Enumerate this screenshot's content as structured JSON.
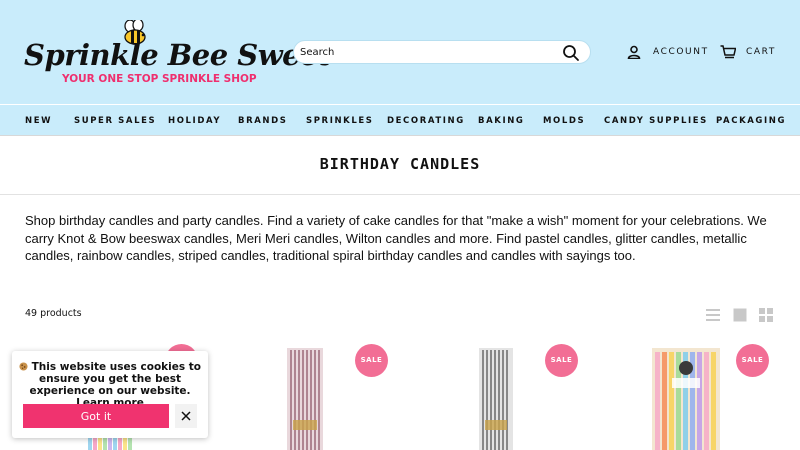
{
  "header": {
    "logo_title": "Sprinkle Bee Sweet",
    "logo_tm": "™",
    "logo_tagline": "YOUR ONE STOP SPRINKLE SHOP",
    "search_placeholder": "Search",
    "account_label": "ACCOUNT",
    "cart_label": "CART"
  },
  "nav": {
    "items": [
      "NEW",
      "SUPER SALES",
      "HOLIDAY",
      "BRANDS",
      "SPRINKLES",
      "DECORATING",
      "BAKING",
      "MOLDS",
      "CANDY SUPPLIES",
      "PACKAGING"
    ]
  },
  "collection": {
    "title": "BIRTHDAY CANDLES",
    "description": "Shop birthday candles and party candles. Find a variety of cake candles for that \"make a wish\" moment for your celebrations. We carry Knot & Bow beeswax candles, Meri Meri candles, Wilton candles and more. Find pastel candles, glitter candles, metallic candles, rainbow candles, striped candles, traditional spiral birthday candles and candles with sayings too.",
    "product_count": "49 products"
  },
  "products": [
    {
      "badge": "SALE"
    },
    {
      "badge": "SALE"
    },
    {
      "badge": "SALE"
    },
    {
      "badge": "SALE"
    }
  ],
  "cookie_banner": {
    "message_prefix": "This website uses cookies to ensure you get the best experience on our website.",
    "learn_more": "Learn more",
    "accept_label": "Got it"
  },
  "colors": {
    "header_bg": "#c9ecfb",
    "accent_pink": "#f0336f",
    "sale_badge": "#f26e95"
  },
  "icons": {
    "search": "search-icon",
    "account": "account-icon",
    "cart": "cart-icon",
    "view_list": "list-view-icon",
    "view_large": "large-grid-icon",
    "view_small": "small-grid-icon",
    "close": "close-icon",
    "cookie": "cookie-icon"
  }
}
